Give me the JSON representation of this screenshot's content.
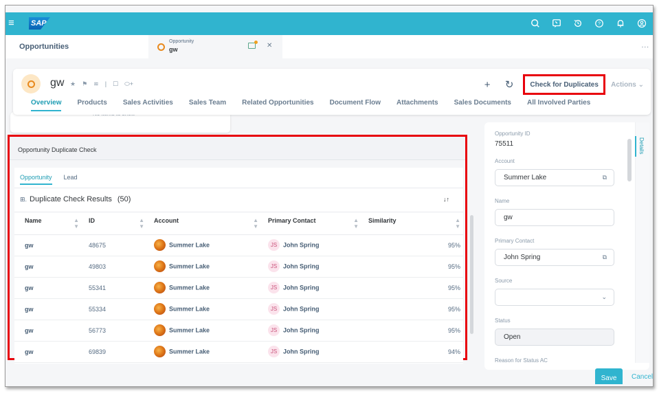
{
  "shell": {
    "menu_icon": "hamburger-icon",
    "logo": "SAP",
    "icons": [
      "search-icon",
      "feedback-icon",
      "history-icon",
      "help-icon",
      "notification-bell-icon",
      "user-profile-icon"
    ]
  },
  "tabstrip": {
    "home_tab": "Opportunities",
    "doc_tab": {
      "subtitle": "Opportunity",
      "title": "gw"
    },
    "more": "..."
  },
  "object_header": {
    "title": "gw",
    "meta_icons": [
      "star-icon",
      "flag-icon",
      "rss-icon",
      "|",
      "comment-icon",
      "tag-icon",
      "+"
    ],
    "actions": {
      "add": "+",
      "refresh": "↻",
      "check_duplicates": "Check for Duplicates",
      "actions_label": "Actions ⌄"
    },
    "nav_tabs": [
      "Overview",
      "Products",
      "Sales Activities",
      "Sales Team",
      "Related Opportunities",
      "Document Flow",
      "Attachments",
      "Sales Documents",
      "All Involved Parties"
    ],
    "active_tab": "Overview"
  },
  "prev_card": {
    "text": "No items to show"
  },
  "duplicate_check": {
    "title": "Opportunity Duplicate Check",
    "tabs": [
      "Opportunity",
      "Lead"
    ],
    "active_tab": "Opportunity",
    "results_title": "Duplicate Check Results",
    "results_count": "(50)",
    "columns": [
      "Name",
      "ID",
      "Account",
      "Primary Contact",
      "Similarity"
    ],
    "rows": [
      {
        "name": "gw",
        "id": "48675",
        "account": "Summer Lake",
        "contact_initials": "JS",
        "contact": "John Spring",
        "similarity": "95%"
      },
      {
        "name": "gw",
        "id": "49803",
        "account": "Summer Lake",
        "contact_initials": "JS",
        "contact": "John Spring",
        "similarity": "95%"
      },
      {
        "name": "gw",
        "id": "55341",
        "account": "Summer Lake",
        "contact_initials": "JS",
        "contact": "John Spring",
        "similarity": "95%"
      },
      {
        "name": "gw",
        "id": "55334",
        "account": "Summer Lake",
        "contact_initials": "JS",
        "contact": "John Spring",
        "similarity": "95%"
      },
      {
        "name": "gw",
        "id": "56773",
        "account": "Summer Lake",
        "contact_initials": "JS",
        "contact": "John Spring",
        "similarity": "95%"
      },
      {
        "name": "gw",
        "id": "69839",
        "account": "Summer Lake",
        "contact_initials": "JS",
        "contact": "John Spring",
        "similarity": "94%"
      }
    ]
  },
  "details_panel": {
    "rail_label": "Details",
    "opportunity_id_label": "Opportunity ID",
    "opportunity_id": "75511",
    "account_label": "Account",
    "account": "Summer Lake",
    "name_label": "Name",
    "name": "gw",
    "primary_contact_label": "Primary Contact",
    "primary_contact": "John Spring",
    "source_label": "Source",
    "source": "",
    "status_label": "Status",
    "status": "Open",
    "reason_label": "Reason for Status AC"
  },
  "footer": {
    "save": "Save",
    "cancel": "Cancel"
  },
  "colors": {
    "shell": "#30b4cf",
    "highlight": "#e8000b",
    "accent": "#1d9cb3"
  }
}
